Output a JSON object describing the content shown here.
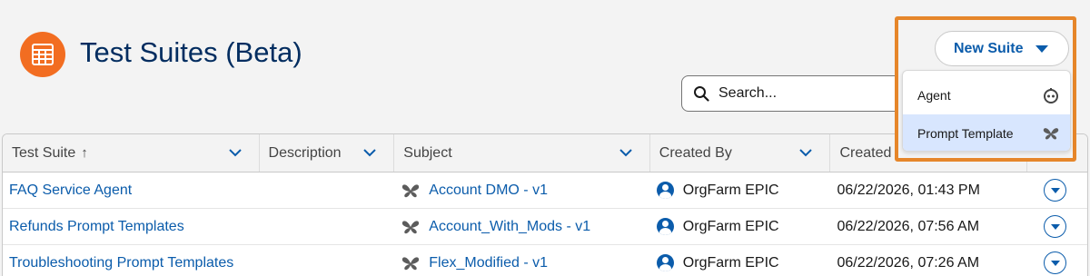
{
  "page": {
    "title": "Test Suites (Beta)",
    "icon": "table-icon",
    "accent": "#f26d21"
  },
  "search": {
    "placeholder": "Search..."
  },
  "new_suite": {
    "label": "New Suite",
    "menu": [
      {
        "label": "Agent",
        "icon": "agent-icon"
      },
      {
        "label": "Prompt Template",
        "icon": "butterfly-icon"
      }
    ]
  },
  "table": {
    "columns": [
      "Test Suite",
      "Description",
      "Subject",
      "Created By",
      "Created"
    ],
    "sort_indicator": "↑",
    "rows": [
      {
        "name": "FAQ Service Agent",
        "description": "",
        "subject": "Account DMO - v1",
        "created_by": "OrgFarm EPIC",
        "created": "06/22/2026, 01:43 PM"
      },
      {
        "name": "Refunds Prompt Templates",
        "description": "",
        "subject": "Account_With_Mods - v1",
        "created_by": "OrgFarm EPIC",
        "created": "06/22/2026, 07:56 AM"
      },
      {
        "name": "Troubleshooting Prompt Templates",
        "description": "",
        "subject": "Flex_Modified - v1",
        "created_by": "OrgFarm EPIC",
        "created": "06/22/2026, 07:26 AM"
      }
    ]
  },
  "colors": {
    "link": "#0b5cab",
    "highlight": "#e6862a",
    "title": "#032d60"
  }
}
